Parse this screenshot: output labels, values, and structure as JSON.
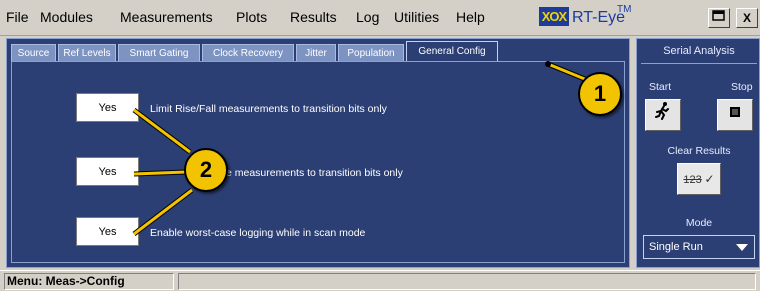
{
  "menu": {
    "items": [
      "File",
      "Modules",
      "Measurements",
      "Plots",
      "Results",
      "Log",
      "Utilities",
      "Help"
    ],
    "logo_mark": "XOX",
    "logo_text": "RT-Eye",
    "logo_tm": "TM",
    "window_buttons": [
      "minimize-icon",
      "close-icon"
    ],
    "close_glyph": "X"
  },
  "tabs": [
    "Source",
    "Ref Levels",
    "Smart Gating",
    "Clock Recovery",
    "Jitter",
    "Population",
    "General Config"
  ],
  "active_tab": "General Config",
  "options": [
    {
      "value": "Yes",
      "label": "Limit Rise/Fall measurements to transition bits only"
    },
    {
      "value": "Yes",
      "label": "e measurements to transition bits only"
    },
    {
      "value": "Yes",
      "label": "Enable worst-case logging while in scan mode"
    }
  ],
  "side_panel": {
    "title": "Serial Analysis",
    "start_label": "Start",
    "stop_label": "Stop",
    "start_icon": "runner-icon",
    "stop_icon": "stop-square-icon",
    "clear_label": "Clear Results",
    "clear_button_text": "123",
    "mode_label": "Mode",
    "mode_value": "Single Run"
  },
  "status": {
    "menu_path": "Menu: Meas->Config"
  },
  "callouts": [
    "1",
    "2"
  ],
  "colors": {
    "panel_bg": "#2c3f74",
    "tab_bg": "#7d93c2",
    "callout": "#f2c300",
    "chrome": "#d4d0c8"
  }
}
